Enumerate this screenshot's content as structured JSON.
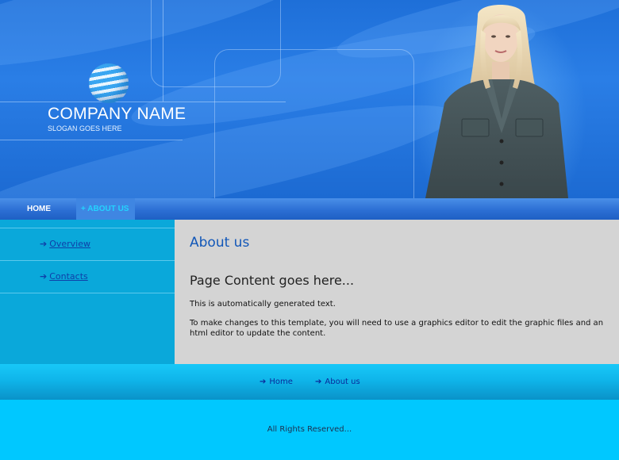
{
  "brand": {
    "company_name": "COMPANY NAME",
    "slogan": "SLOGAN GOES HERE",
    "logo_icon": "globe-icon"
  },
  "nav": {
    "items": [
      {
        "label": "HOME",
        "active": false
      },
      {
        "label": "+ ABOUT US",
        "active": true
      }
    ]
  },
  "sidebar": {
    "items": [
      {
        "label": "Overview",
        "icon": "arrow-right-icon"
      },
      {
        "label": "Contacts",
        "icon": "arrow-right-icon"
      }
    ]
  },
  "content": {
    "title": "About us",
    "heading": "Page Content goes here...",
    "paragraphs": [
      "This is automatically generated text.",
      "To make changes to this template, you will need to use a graphics editor to edit the graphic files and an html editor to update the content."
    ]
  },
  "footer": {
    "links": [
      {
        "label": "Home"
      },
      {
        "label": "About us"
      }
    ],
    "copyright": "All Rights Reserved..."
  },
  "colors": {
    "header_blue": "#1e6fd8",
    "nav_blue": "#2c6fd4",
    "active_tab_text": "#23d3ff",
    "sidebar_cyan": "#0aa8da",
    "content_gray": "#d4d4d4",
    "title_blue": "#1257b8",
    "footer_cyan": "#00c8ff"
  }
}
